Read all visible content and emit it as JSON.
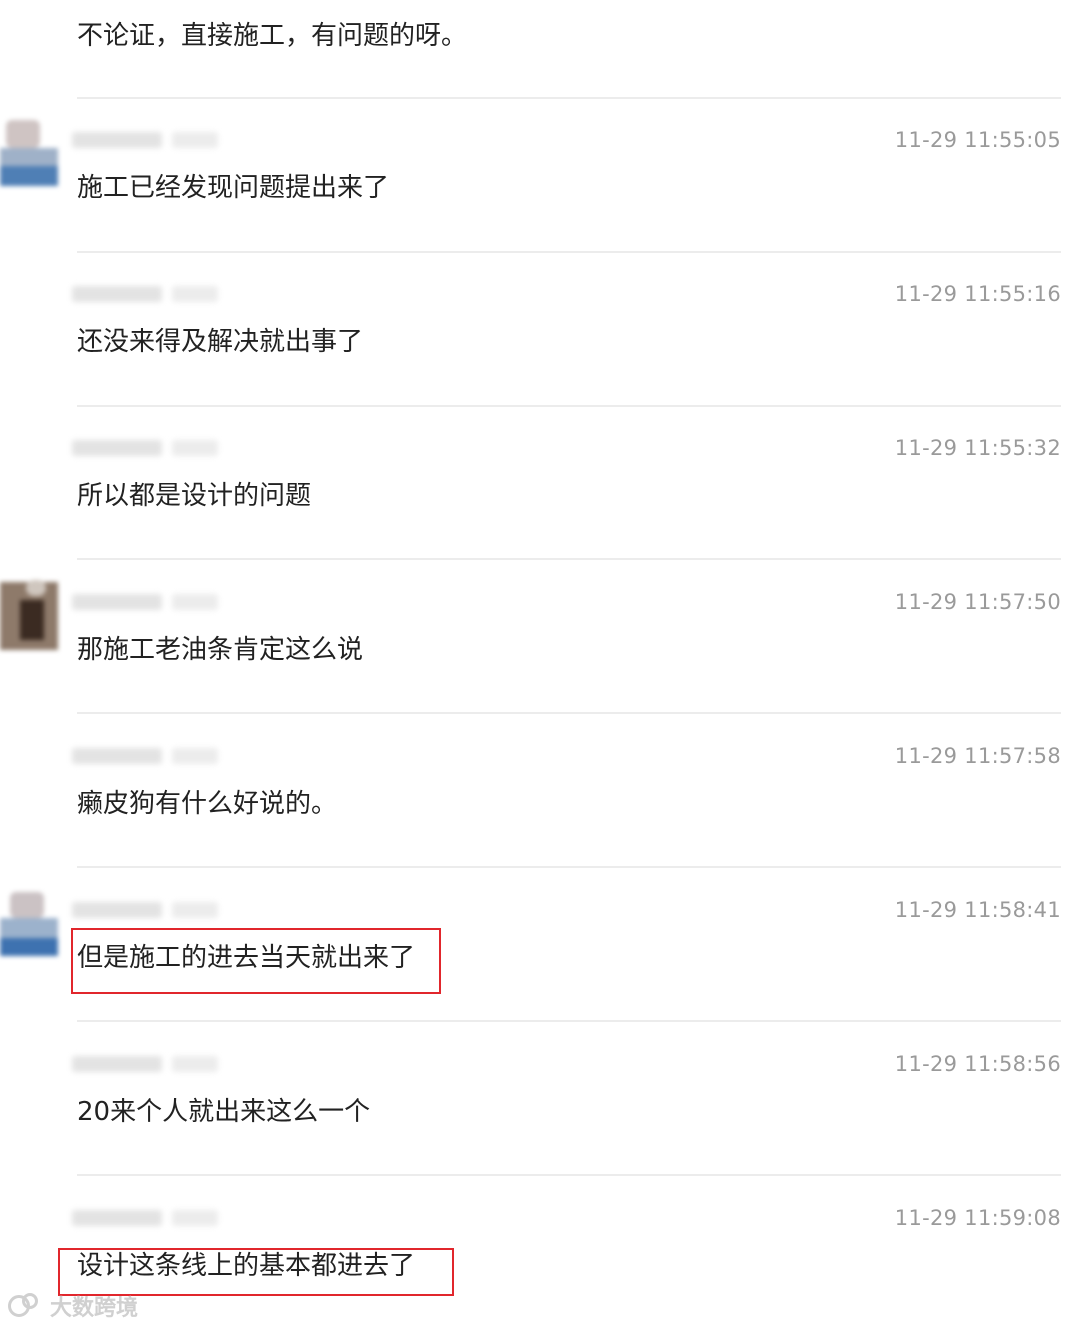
{
  "top_message": "不论证，直接施工，有问题的呀。",
  "messages": [
    {
      "time": "11-29 11:55:05",
      "text": "施工已经发现问题提出来了"
    },
    {
      "time": "11-29 11:55:16",
      "text": "还没来得及解决就出事了"
    },
    {
      "time": "11-29 11:55:32",
      "text": "所以都是设计的问题"
    },
    {
      "time": "11-29 11:57:50",
      "text": "那施工老油条肯定这么说"
    },
    {
      "time": "11-29 11:57:58",
      "text": "癞皮狗有什么好说的。"
    },
    {
      "time": "11-29 11:58:41",
      "text": "但是施工的进去当天就出来了"
    },
    {
      "time": "11-29 11:58:56",
      "text": "20来个人就出来这么一个"
    },
    {
      "time": "11-29 11:59:08",
      "text": "设计这条线上的基本都进去了"
    }
  ],
  "highlight_color": "#e1262c",
  "watermark": "大数跨境"
}
